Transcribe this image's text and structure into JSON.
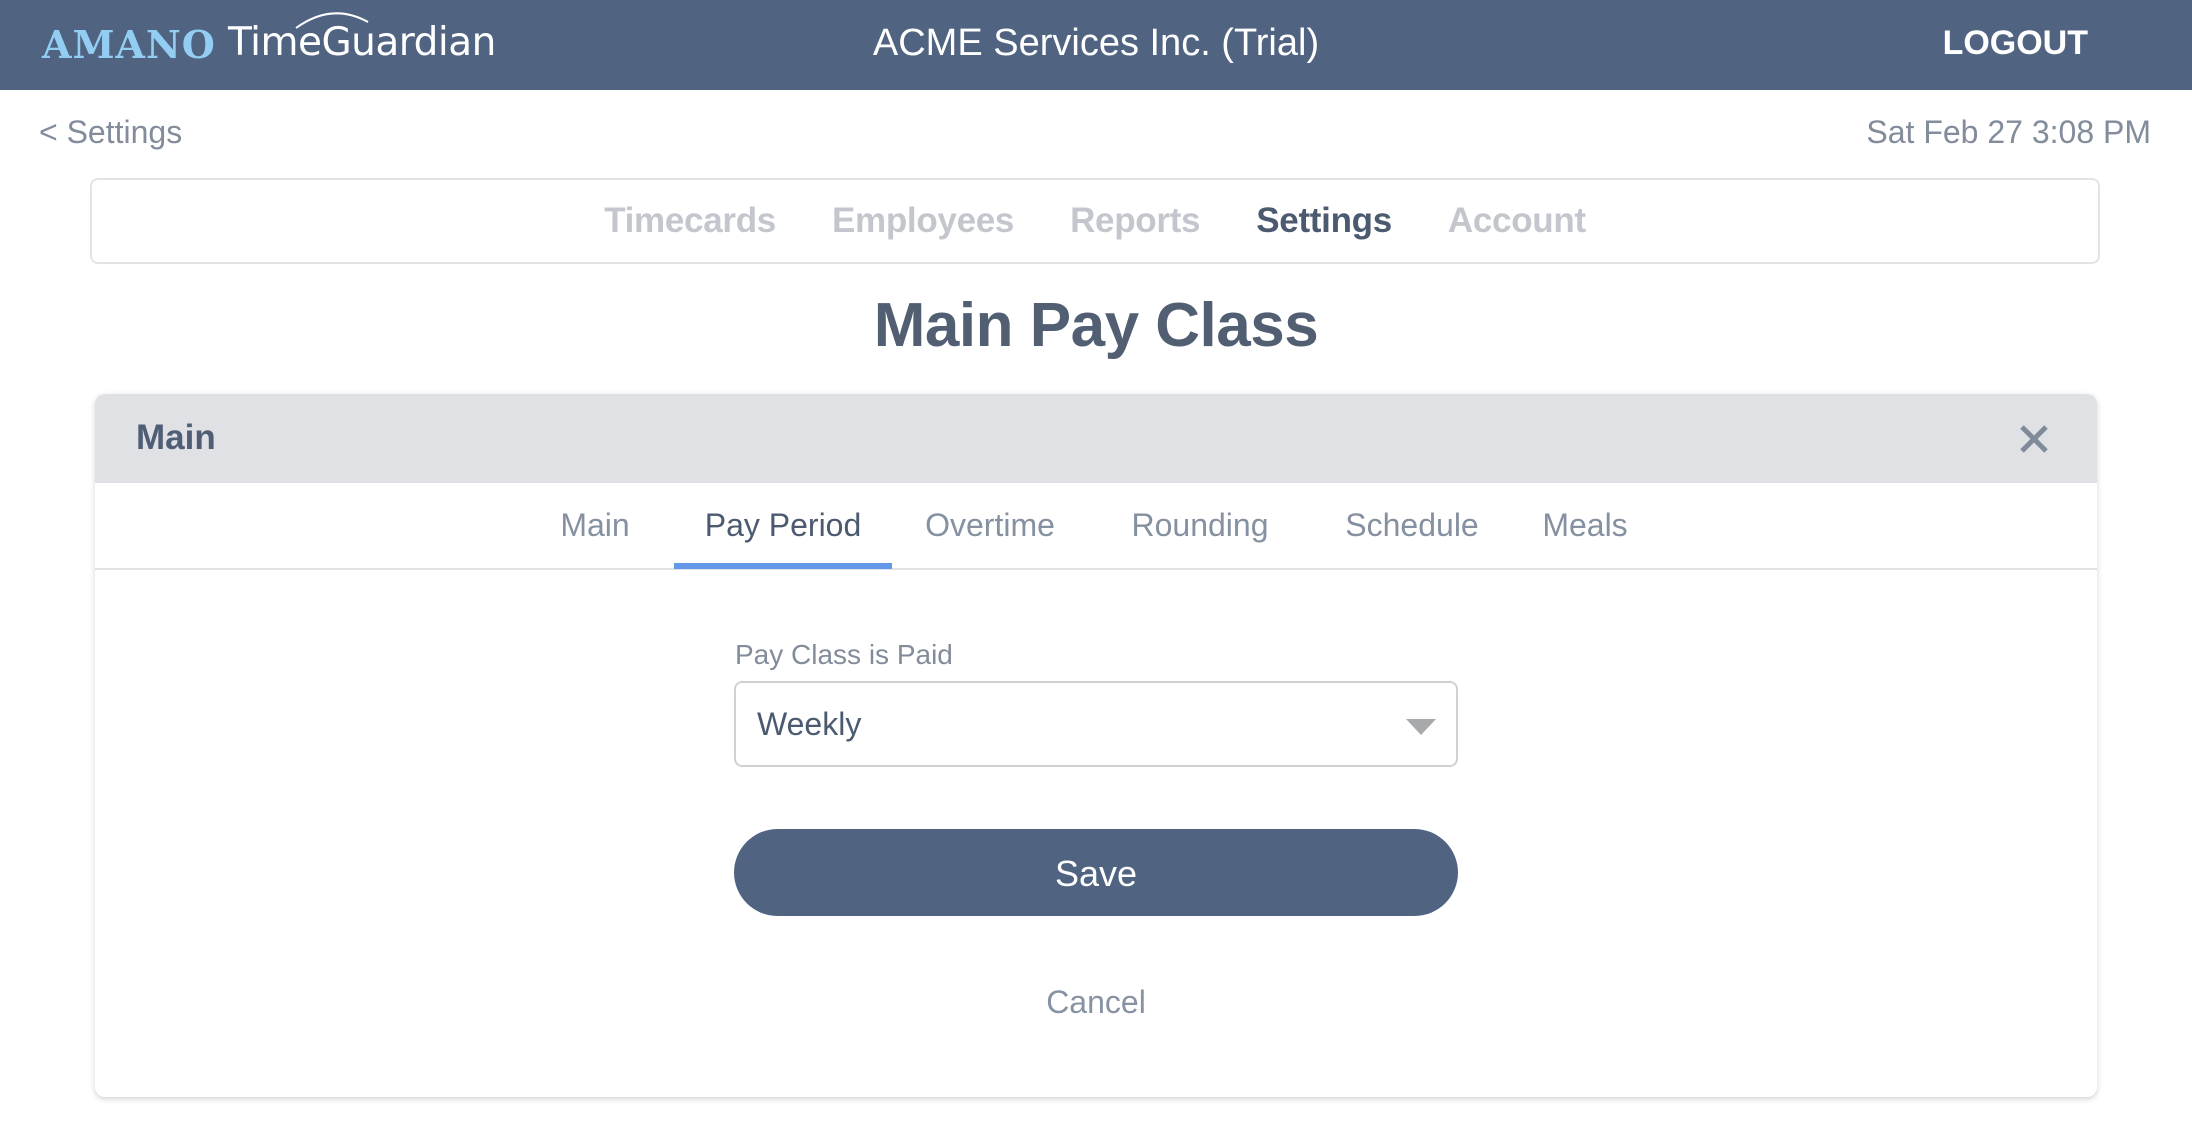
{
  "header": {
    "logo": {
      "brand": "AMANO",
      "product": "TimeGuardian"
    },
    "company": "ACME Services Inc. (Trial)",
    "logout_label": "LOGOUT",
    "background_color": "#506482"
  },
  "subheader": {
    "back_label": "< Settings",
    "datetime": "Sat Feb 27 3:08 PM"
  },
  "nav": {
    "items": [
      {
        "label": "Timecards",
        "active": false
      },
      {
        "label": "Employees",
        "active": false
      },
      {
        "label": "Reports",
        "active": false
      },
      {
        "label": "Settings",
        "active": true
      },
      {
        "label": "Account",
        "active": false
      }
    ]
  },
  "page": {
    "title": "Main Pay Class"
  },
  "card": {
    "title": "Main",
    "close_icon": "close-icon",
    "tabs": [
      {
        "label": "Main",
        "active": false
      },
      {
        "label": "Pay Period",
        "active": true
      },
      {
        "label": "Overtime",
        "active": false
      },
      {
        "label": "Rounding",
        "active": false
      },
      {
        "label": "Schedule",
        "active": false
      },
      {
        "label": "Meals",
        "active": false
      }
    ],
    "active_tab_color": "#6499e9",
    "form": {
      "pay_class_paid": {
        "label": "Pay Class is Paid",
        "value": "Weekly",
        "icon": "chevron-down-icon"
      },
      "save_label": "Save",
      "cancel_label": "Cancel"
    }
  }
}
